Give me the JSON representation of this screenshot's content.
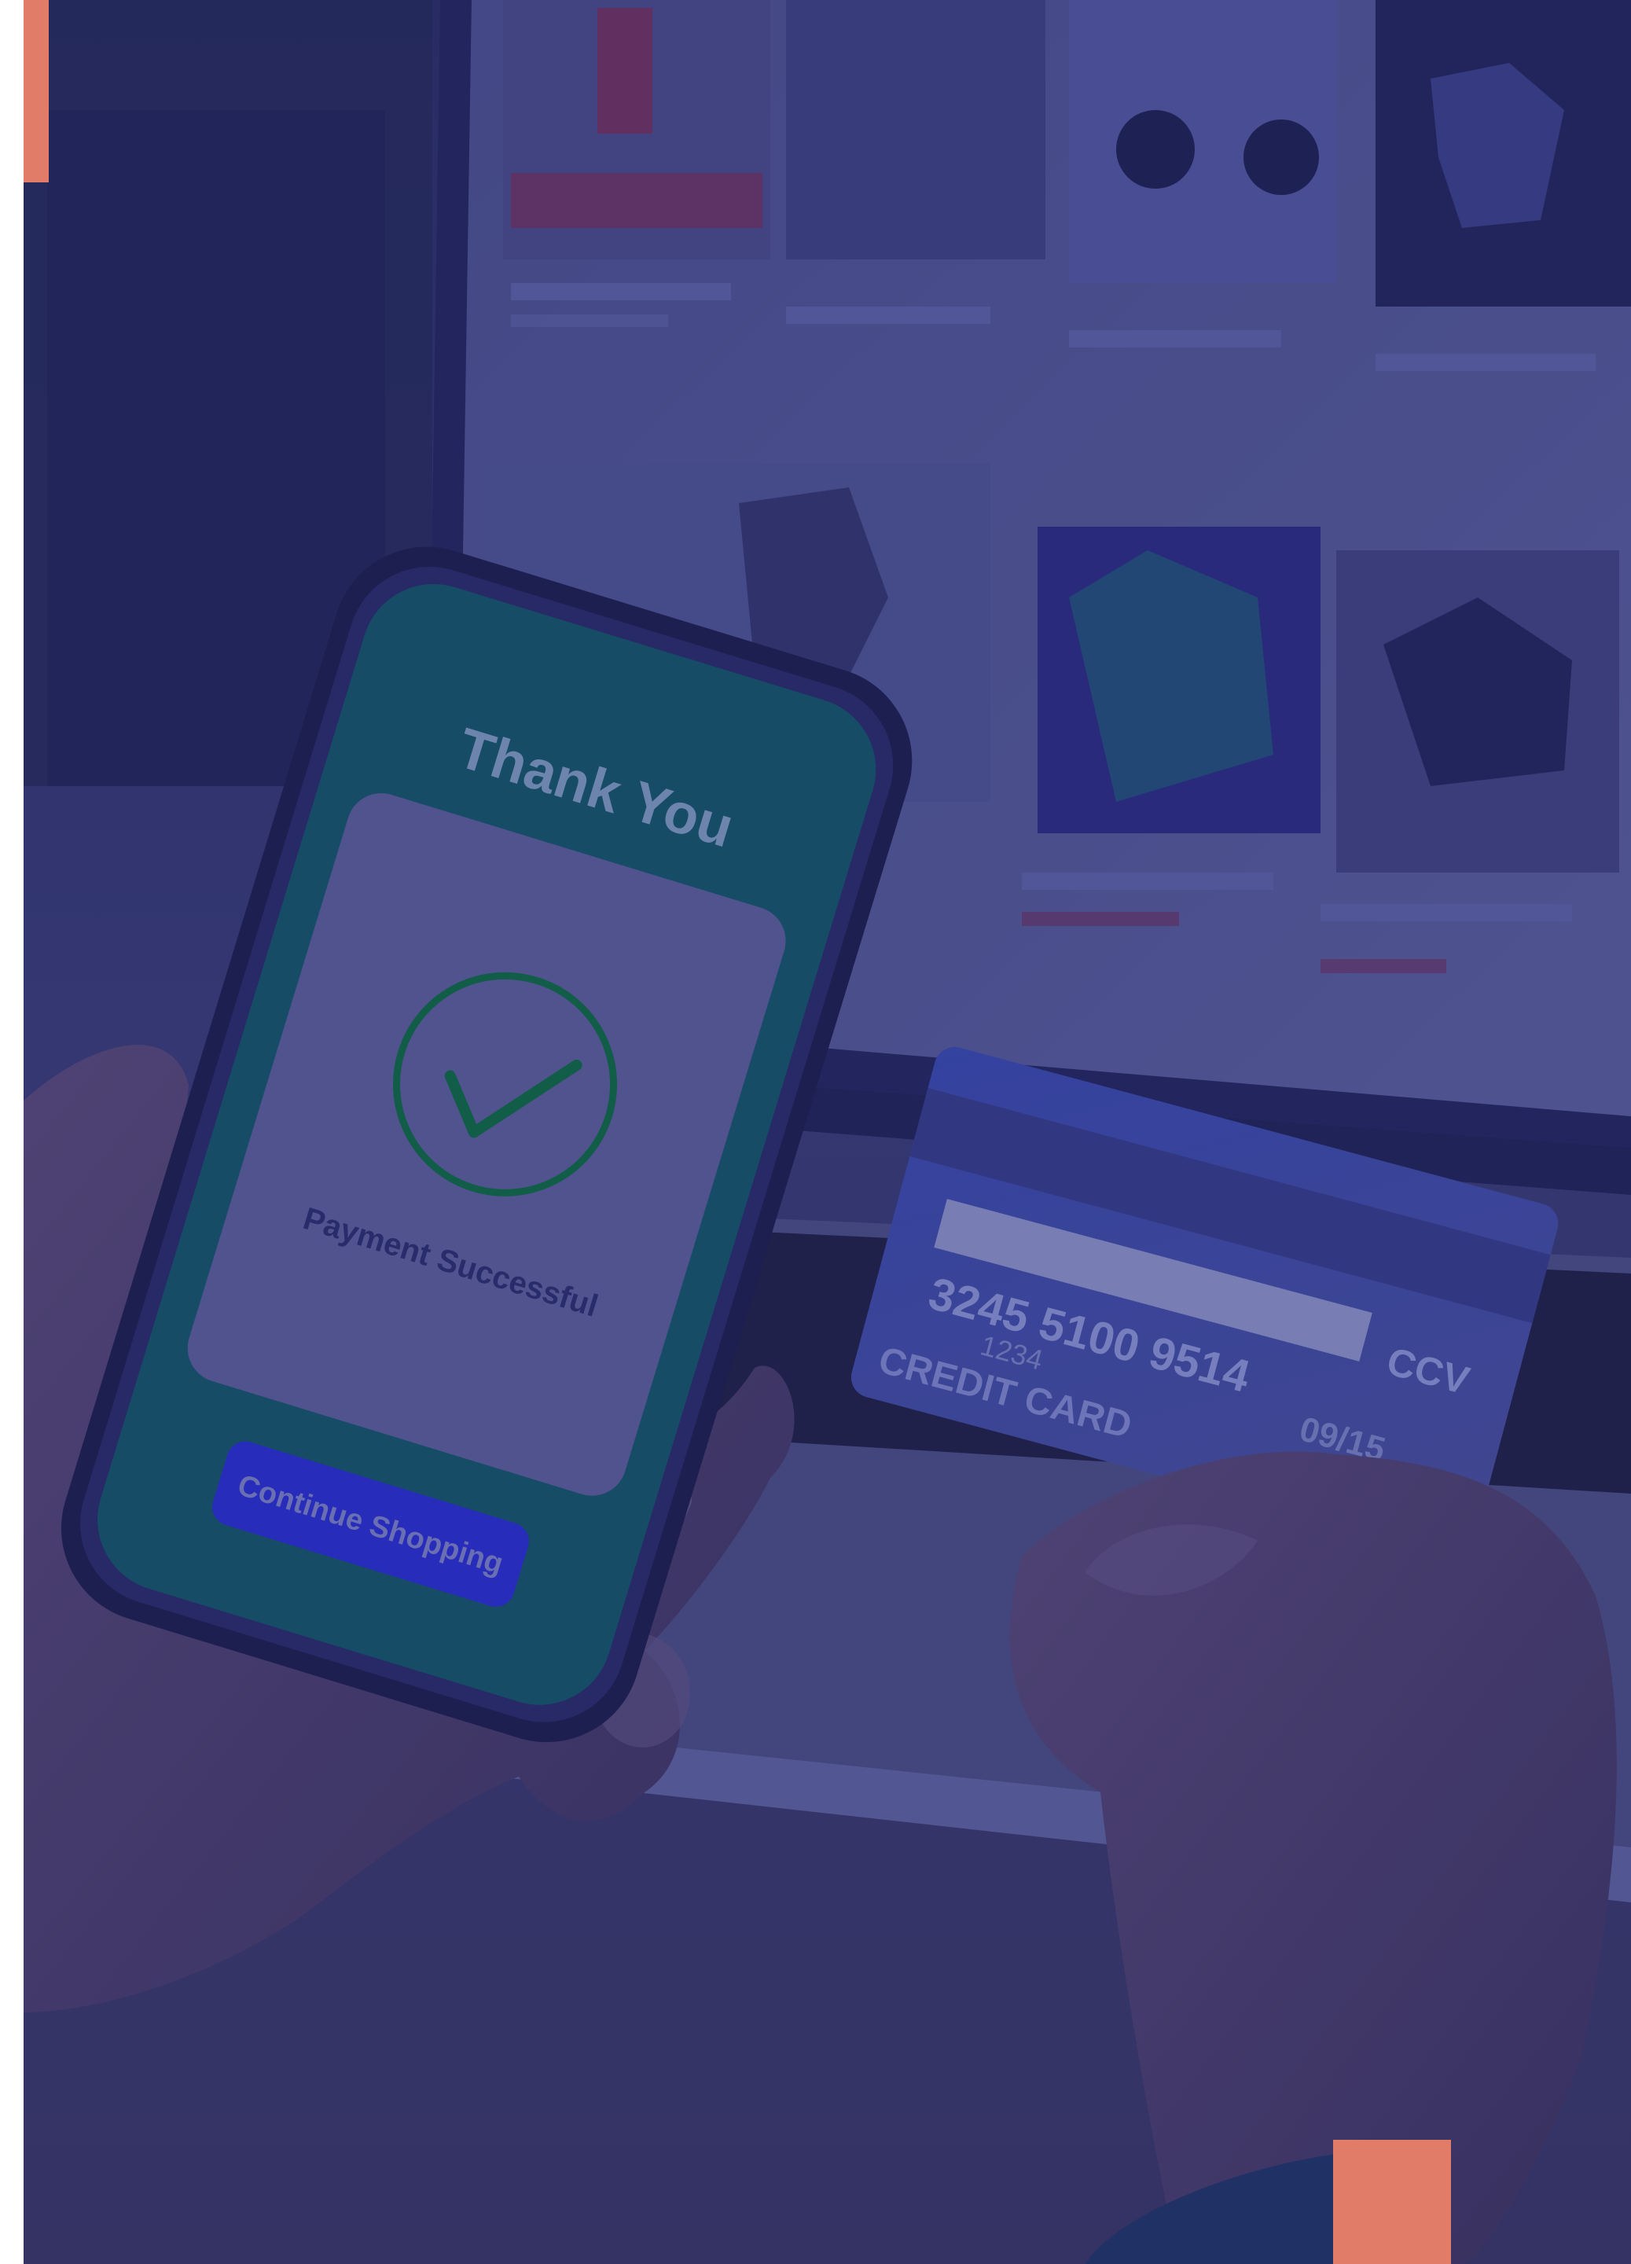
{
  "colors": {
    "overlay": "#33336e",
    "accent": "#e07c67",
    "phone_screen": "#17566b",
    "card_blue": "#3849a8",
    "check_green": "#0f6b44",
    "button_blue": "#2a2fd0"
  },
  "phone": {
    "title": "Thank You",
    "status": "Payment Successful",
    "button_label": "Continue Shopping"
  },
  "credit_card": {
    "number_partial": "3245 5100 9514",
    "label": "CREDIT CARD",
    "ccv_label": "CCV",
    "date_fragment": "1234",
    "expiry_fragment": "09/15"
  },
  "icons": {
    "check": "check-circle-icon"
  }
}
